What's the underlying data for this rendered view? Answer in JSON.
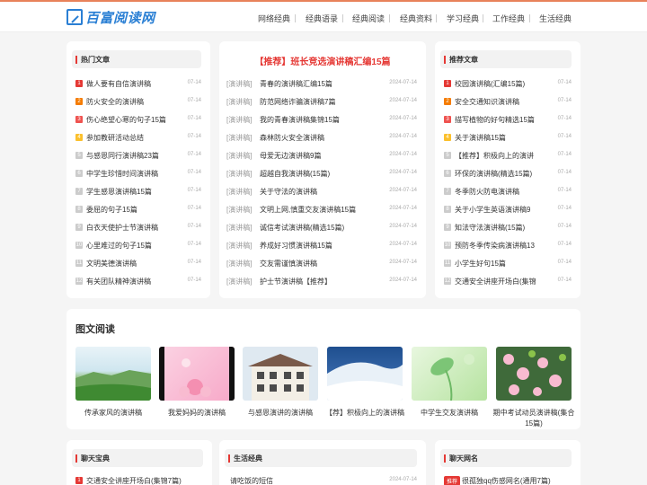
{
  "header": {
    "logo_text": "百富阅读网",
    "nav": [
      "网络经典",
      "经典语录",
      "经典阅读",
      "经典资料",
      "学习经典",
      "工作经典",
      "生活经典"
    ]
  },
  "hot": {
    "title": "热门文章",
    "items": [
      {
        "n": "1",
        "text": "做人要有自信演讲稿",
        "date": "07-14"
      },
      {
        "n": "2",
        "text": "防火安全的演讲稿",
        "date": "07-14"
      },
      {
        "n": "3",
        "text": "伤心绝望心寒的句子15篇",
        "date": "07-14"
      },
      {
        "n": "4",
        "text": "参加教研活动总结",
        "date": "07-14"
      },
      {
        "n": "5",
        "text": "与感恩同行演讲稿23篇",
        "date": "07-14"
      },
      {
        "n": "6",
        "text": "中学生珍惜时间演讲稿",
        "date": "07-14"
      },
      {
        "n": "7",
        "text": "学生感恩演讲稿15篇",
        "date": "07-14"
      },
      {
        "n": "8",
        "text": "委屈的句子15篇",
        "date": "07-14"
      },
      {
        "n": "9",
        "text": "白衣天使护士节演讲稿",
        "date": "07-14"
      },
      {
        "n": "10",
        "text": "心里难过的句子15篇",
        "date": "07-14"
      },
      {
        "n": "11",
        "text": "文明美德演讲稿",
        "date": "07-14"
      },
      {
        "n": "12",
        "text": "有关团队精神演讲稿",
        "date": "07-14"
      }
    ]
  },
  "featured": {
    "title": "【推荐】班长竞选演讲稿汇编15篇",
    "items": [
      {
        "cat": "[演讲稿]",
        "text": "青春的演讲稿汇编15篇",
        "date": "2024-07-14"
      },
      {
        "cat": "[演讲稿]",
        "text": "防范网络诈骗演讲稿7篇",
        "date": "2024-07-14"
      },
      {
        "cat": "[演讲稿]",
        "text": "我的青春演讲稿集锦15篇",
        "date": "2024-07-14"
      },
      {
        "cat": "[演讲稿]",
        "text": "森林防火安全演讲稿",
        "date": "2024-07-14"
      },
      {
        "cat": "[演讲稿]",
        "text": "母爱无边演讲稿9篇",
        "date": "2024-07-14"
      },
      {
        "cat": "[演讲稿]",
        "text": "超越自我演讲稿(15篇)",
        "date": "2024-07-14"
      },
      {
        "cat": "[演讲稿]",
        "text": "关于守法的演讲稿",
        "date": "2024-07-14"
      },
      {
        "cat": "[演讲稿]",
        "text": "文明上网,慎重交友演讲稿15篇",
        "date": "2024-07-14"
      },
      {
        "cat": "[演讲稿]",
        "text": "诚信考试演讲稿(精选15篇)",
        "date": "2024-07-14"
      },
      {
        "cat": "[演讲稿]",
        "text": "养成好习惯演讲稿15篇",
        "date": "2024-07-14"
      },
      {
        "cat": "[演讲稿]",
        "text": "交友需谨慎演讲稿",
        "date": "2024-07-14"
      },
      {
        "cat": "[演讲稿]",
        "text": "护士节演讲稿【推荐】",
        "date": "2024-07-14"
      }
    ]
  },
  "recommend": {
    "title": "推荐文章",
    "items": [
      {
        "n": "1",
        "text": "校园演讲稿(汇编15篇)",
        "date": "07-14"
      },
      {
        "n": "2",
        "text": "安全交通知识演讲稿",
        "date": "07-14"
      },
      {
        "n": "3",
        "text": "描写植物的好句精选15篇",
        "date": "07-14"
      },
      {
        "n": "4",
        "text": "关于演讲稿15篇",
        "date": "07-14"
      },
      {
        "n": "5",
        "text": "【推荐】积极向上的演讲",
        "date": "07-14"
      },
      {
        "n": "6",
        "text": "环保的演讲稿(精选15篇)",
        "date": "07-14"
      },
      {
        "n": "7",
        "text": "冬季防火防电演讲稿",
        "date": "07-14"
      },
      {
        "n": "8",
        "text": "关于小学生英语演讲稿9",
        "date": "07-14"
      },
      {
        "n": "9",
        "text": "知法守法演讲稿(15篇)",
        "date": "07-14"
      },
      {
        "n": "10",
        "text": "预防冬季传染病演讲稿13",
        "date": "07-14"
      },
      {
        "n": "11",
        "text": "小学生好句15篇",
        "date": "07-14"
      },
      {
        "n": "12",
        "text": "交通安全讲座开场白(集锦",
        "date": "07-14"
      }
    ]
  },
  "gallery": {
    "title": "图文阅读",
    "items": [
      {
        "caption": "传承家风的演讲稿",
        "icon": "landscape-photo"
      },
      {
        "caption": "我爱妈妈的演讲稿",
        "icon": "flower-photo"
      },
      {
        "caption": "与感恩演讲的演讲稿",
        "icon": "building-photo"
      },
      {
        "caption": "【荐】积极向上的演讲稿",
        "icon": "snow-photo"
      },
      {
        "caption": "中学生交友演讲稿",
        "icon": "leaf-photo"
      },
      {
        "caption": "期中考试动员演讲稿(集合15篇)",
        "icon": "blossom-photo"
      }
    ]
  },
  "bottom": {
    "left": {
      "title": "聊天宝典",
      "item": "交通安全讲座开场白(集锦7篇)"
    },
    "mid": {
      "title": "生活经典",
      "item": "请吃饭的短信",
      "date": "2024-07-14"
    },
    "right": {
      "title": "聊天网名",
      "badge": "推荐",
      "item": "很孤独qq伤感网名(通用7篇)"
    }
  },
  "colors": {
    "accent": "#e53935",
    "logo": "#2a7fd4",
    "topline": "#e8825a"
  }
}
